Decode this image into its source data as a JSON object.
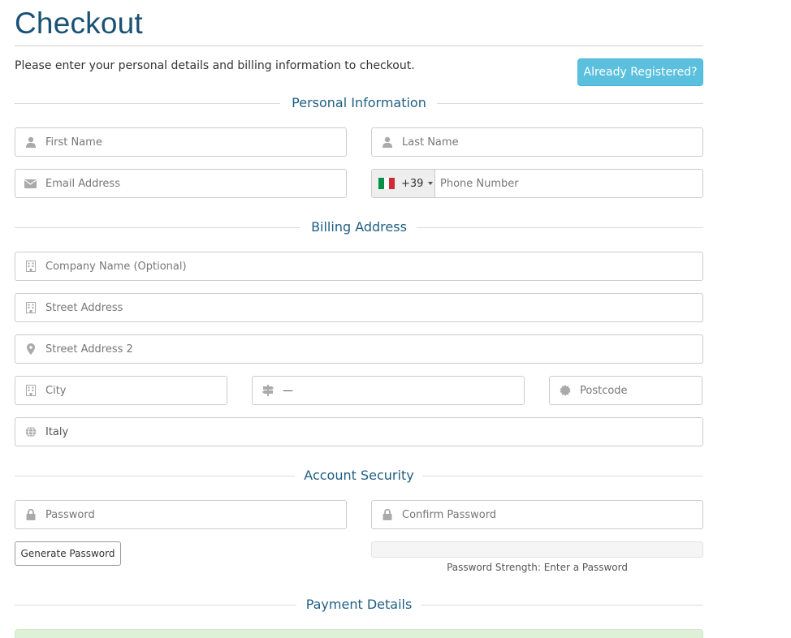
{
  "page": {
    "title": "Checkout",
    "intro": "Please enter your personal details and billing information to checkout.",
    "already_registered_label": "Already Registered?"
  },
  "sections": {
    "personal": "Personal Information",
    "billing": "Billing Address",
    "security": "Account Security",
    "payment": "Payment Details"
  },
  "personal": {
    "first_name_placeholder": "First Name",
    "last_name_placeholder": "Last Name",
    "email_placeholder": "Email Address",
    "phone_country_code": "+39",
    "phone_country_flag": "italy-flag-icon",
    "phone_placeholder": "Phone Number"
  },
  "billing": {
    "company_placeholder": "Company Name (Optional)",
    "street1_placeholder": "Street Address",
    "street2_placeholder": "Street Address 2",
    "city_placeholder": "City",
    "state_value": "—",
    "postcode_placeholder": "Postcode",
    "country_value": "Italy"
  },
  "security": {
    "password_placeholder": "Password",
    "confirm_password_placeholder": "Confirm Password",
    "generate_label": "Generate Password",
    "strength_text": "Password Strength: Enter a Password"
  },
  "colors": {
    "title": "#1a5276",
    "section_heading": "#1f5e83",
    "info_button": "#5bc0de",
    "payment_box": "#dff0d8",
    "flag_green": "#009246",
    "flag_white": "#ffffff",
    "flag_red": "#ce2b37"
  },
  "icons": {
    "first_name": "user-icon",
    "last_name": "user-icon",
    "email": "envelope-icon",
    "company": "building-icon",
    "street1": "building-icon",
    "street2": "map-marker-icon",
    "city": "building-icon",
    "state": "signpost-icon",
    "postcode": "certificate-icon",
    "country": "globe-icon",
    "password": "lock-icon",
    "confirm_password": "lock-icon"
  }
}
